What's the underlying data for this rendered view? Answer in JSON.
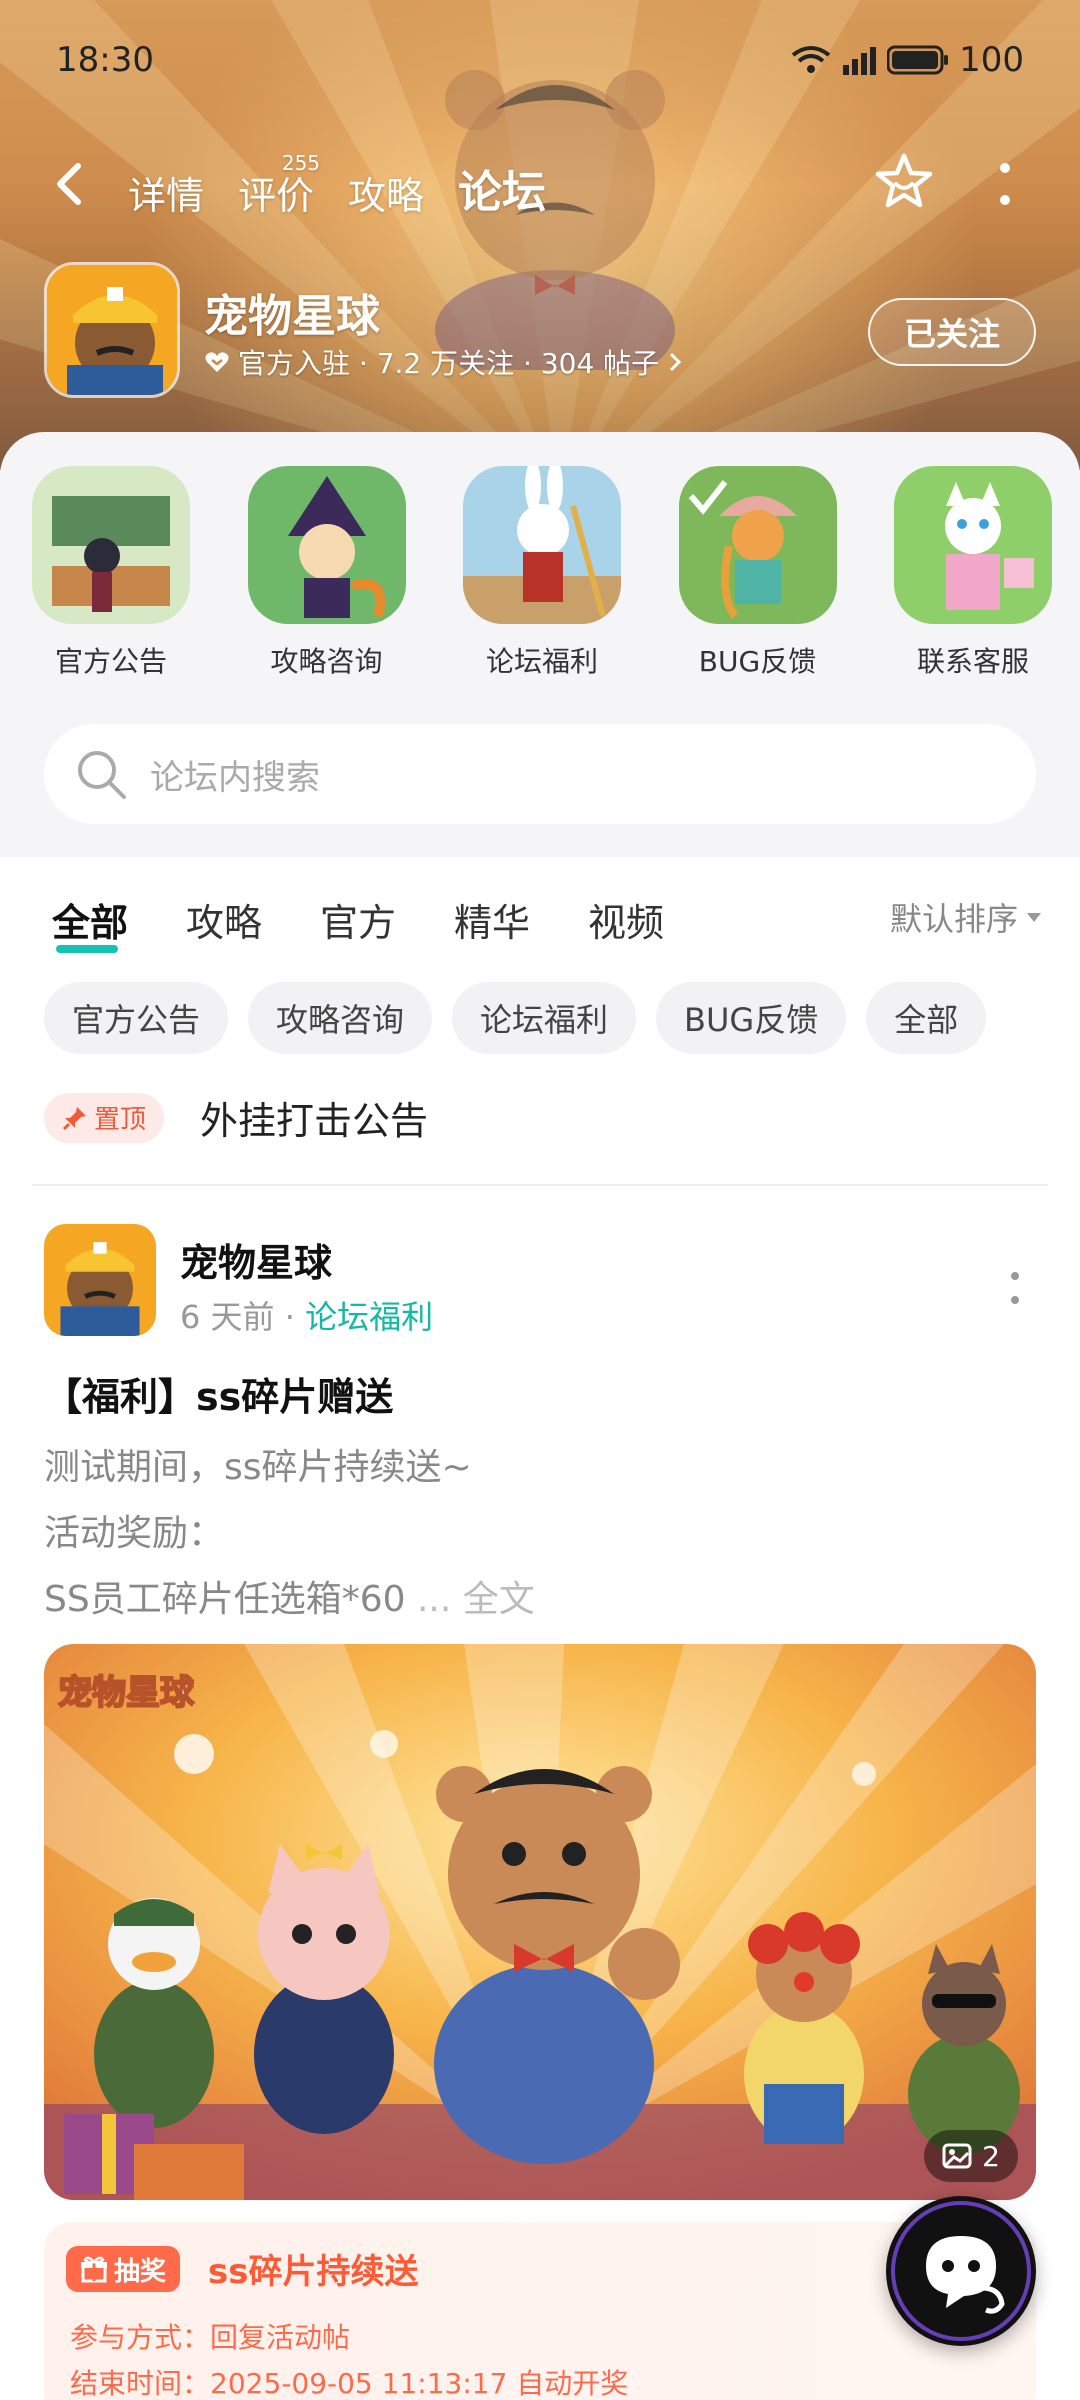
{
  "status": {
    "time": "18:30",
    "battery": "100"
  },
  "nav": {
    "tabs": [
      {
        "label": "详情",
        "badge": ""
      },
      {
        "label": "评价",
        "badge": "255"
      },
      {
        "label": "攻略",
        "badge": ""
      },
      {
        "label": "论坛",
        "badge": ""
      }
    ],
    "active_tab": "论坛"
  },
  "game": {
    "name": "宠物星球",
    "stats": "官方入驻 · 7.2 万关注 · 304 帖子",
    "follow_label": "已关注"
  },
  "boards": [
    {
      "label": "官方公告"
    },
    {
      "label": "攻略咨询"
    },
    {
      "label": "论坛福利"
    },
    {
      "label": "BUG反馈"
    },
    {
      "label": "联系客服"
    }
  ],
  "search": {
    "placeholder": "论坛内搜索"
  },
  "filter_tabs": [
    "全部",
    "攻略",
    "官方",
    "精华",
    "视频"
  ],
  "sort_label": "默认排序",
  "chips": [
    "官方公告",
    "攻略咨询",
    "论坛福利",
    "BUG反馈",
    "全部"
  ],
  "pinned": {
    "badge": "置顶",
    "title": "外挂打击公告"
  },
  "post": {
    "author": "宠物星球",
    "time": "6 天前",
    "board": "论坛福利",
    "title": "【福利】ss碎片赠送",
    "lines": [
      "测试期间，ss碎片持续送~",
      "活动奖励：",
      "SS员工碎片任选箱*60"
    ],
    "more": "... 全文",
    "image_count": "2",
    "banner_logo": "宠物星球"
  },
  "lottery": {
    "tag": "抽奖",
    "title": "ss碎片持续送",
    "method_label": "参与方式：",
    "method": "回复活动帖",
    "end_label": "结束时间：",
    "end": "2025-09-05 11:13:17 自动开奖"
  },
  "colors": {
    "accent": "#18c2b0",
    "orange": "#ff6b4a"
  }
}
